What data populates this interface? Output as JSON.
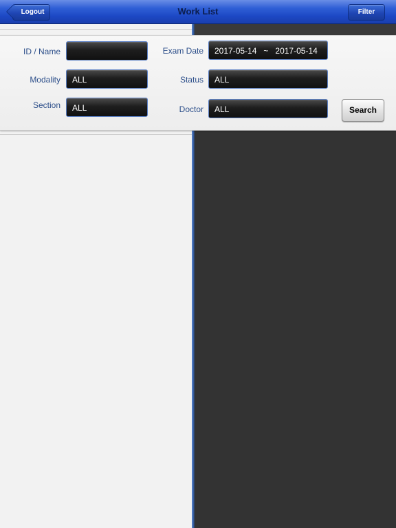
{
  "navbar": {
    "title": "Work List",
    "logout_label": "Logout",
    "filter_label": "Filter",
    "color": "#1c47c4"
  },
  "filters": {
    "id_name": {
      "label": "ID / Name",
      "value": ""
    },
    "exam_date": {
      "label": "Exam Date",
      "from": "2017-05-14",
      "separator": "~",
      "to": "2017-05-14"
    },
    "modality": {
      "label": "Modality",
      "value": "ALL"
    },
    "status": {
      "label": "Status",
      "value": "ALL"
    },
    "section": {
      "label": "Section",
      "value": "ALL"
    },
    "doctor": {
      "label": "Doctor",
      "value": "ALL"
    },
    "search_label": "Search"
  },
  "colors": {
    "label_text": "#2d4f8a",
    "field_bg": "#1e1e1e",
    "field_border": "#5a7fc4",
    "right_pane_bg": "#333333",
    "left_pane_bg": "#f2f2f2"
  }
}
